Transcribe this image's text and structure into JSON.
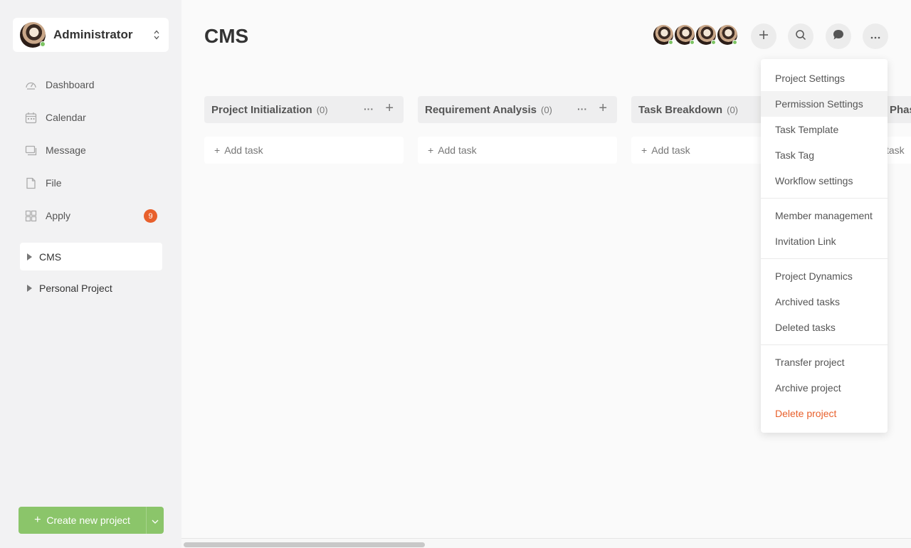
{
  "user": {
    "name": "Administrator"
  },
  "nav": {
    "items": [
      {
        "label": "Dashboard",
        "icon": "dashboard-icon"
      },
      {
        "label": "Calendar",
        "icon": "calendar-icon"
      },
      {
        "label": "Message",
        "icon": "message-icon"
      },
      {
        "label": "File",
        "icon": "file-icon"
      },
      {
        "label": "Apply",
        "icon": "apply-icon",
        "badge": "9"
      }
    ]
  },
  "projects": [
    {
      "label": "CMS",
      "active": true
    },
    {
      "label": "Personal Project",
      "active": false
    }
  ],
  "create_button": {
    "label": "Create new project"
  },
  "page": {
    "title": "CMS"
  },
  "columns": [
    {
      "title": "Project Initialization",
      "count": "(0)",
      "add_task": "Add task"
    },
    {
      "title": "Requirement Analysis",
      "count": "(0)",
      "add_task": "Add task"
    },
    {
      "title": "Task Breakdown",
      "count": "(0)",
      "add_task": "Add task"
    },
    {
      "title": "Phas",
      "count": "",
      "add_task": "task"
    }
  ],
  "menu": {
    "groups": [
      [
        "Project Settings",
        "Permission Settings",
        "Task Template",
        "Task Tag",
        "Workflow settings"
      ],
      [
        "Member management",
        "Invitation Link"
      ],
      [
        "Project Dynamics",
        "Archived tasks",
        "Deleted tasks"
      ],
      [
        "Transfer project",
        "Archive project",
        "Delete project"
      ]
    ],
    "hovered": "Permission Settings"
  },
  "colors": {
    "accent": "#8bc56a",
    "danger": "#e8602c",
    "online": "#7dc464"
  }
}
